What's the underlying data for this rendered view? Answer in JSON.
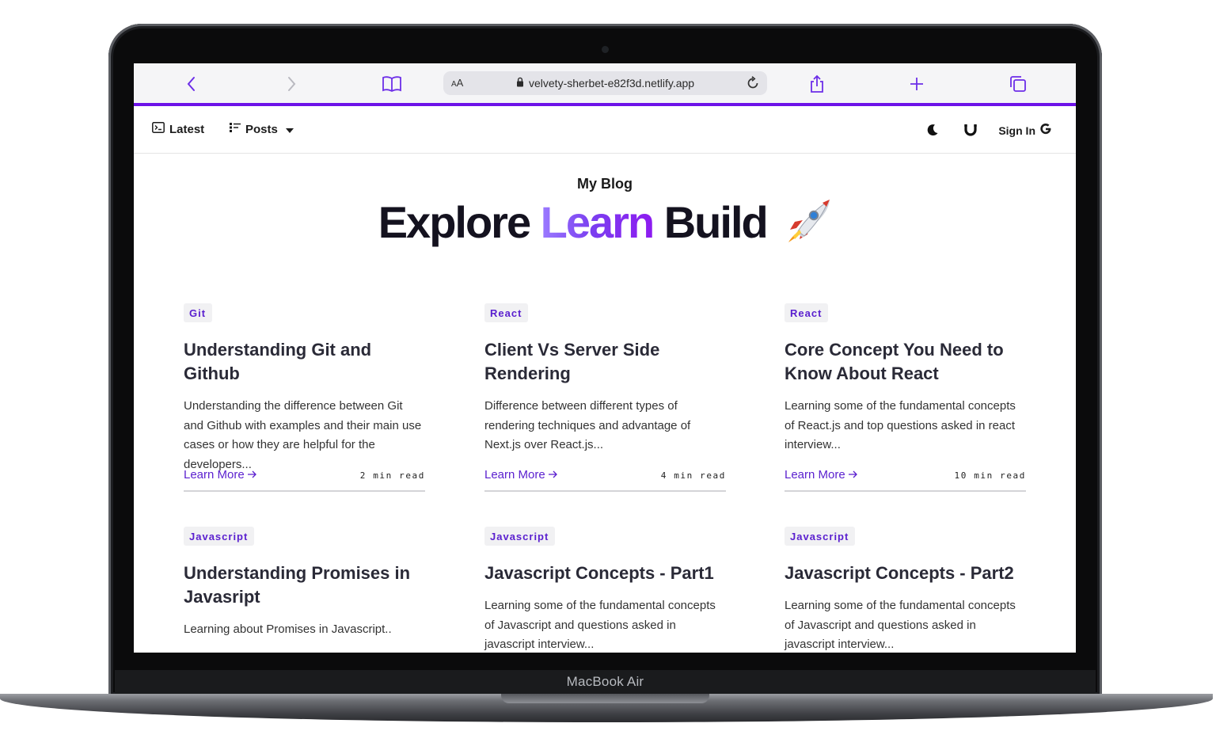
{
  "device": {
    "label": "MacBook Air"
  },
  "browser": {
    "aa_label": "AA",
    "url": "velvety-sherbet-e82f3d.netlify.app",
    "icons": [
      "back-icon",
      "forward-icon",
      "bookmarks-icon",
      "lock-icon",
      "reload-icon",
      "share-icon",
      "new-tab-icon",
      "tabs-icon"
    ]
  },
  "nav": {
    "latest": "Latest",
    "posts": "Posts",
    "signin": "Sign In",
    "icons": [
      "terminal-icon",
      "list-icon",
      "caret-down-icon",
      "moon-icon",
      "magnet-icon",
      "google-icon"
    ]
  },
  "hero": {
    "subtitle": "My Blog",
    "word1": "Explore",
    "word2": "Learn",
    "word3": "Build",
    "emoji": "rocket-icon"
  },
  "colors": {
    "accent": "#6d12e8",
    "tag_text": "#5a1fcf",
    "title": "#14121f"
  },
  "posts": [
    {
      "tag": "Git",
      "title": "Understanding Git and Github",
      "desc": "Understanding the difference between Git and Github with examples and their main use cases or how they are helpful for the developers...",
      "link": "Learn More",
      "read": "2 min read"
    },
    {
      "tag": "React",
      "title": "Client Vs Server Side Rendering",
      "desc": "Difference between different types of rendering techniques and advantage of Next.js over React.js...",
      "link": "Learn More",
      "read": "4 min read"
    },
    {
      "tag": "React",
      "title": "Core Concept You Need to Know About React",
      "desc": "Learning some of the fundamental concepts of React.js and top questions asked in react interview...",
      "link": "Learn More",
      "read": "10 min read"
    },
    {
      "tag": "Javascript",
      "title": "Understanding Promises in Javasript",
      "desc": "Learning about Promises in Javascript..",
      "link": "",
      "read": ""
    },
    {
      "tag": "Javascript",
      "title": "Javascript Concepts - Part1",
      "desc": "Learning some of the fundamental concepts of Javascript and questions asked in javascript interview...",
      "link": "",
      "read": ""
    },
    {
      "tag": "Javascript",
      "title": "Javascript Concepts - Part2",
      "desc": "Learning some of the fundamental concepts of Javascript and questions asked in javascript interview...",
      "link": "",
      "read": ""
    }
  ]
}
